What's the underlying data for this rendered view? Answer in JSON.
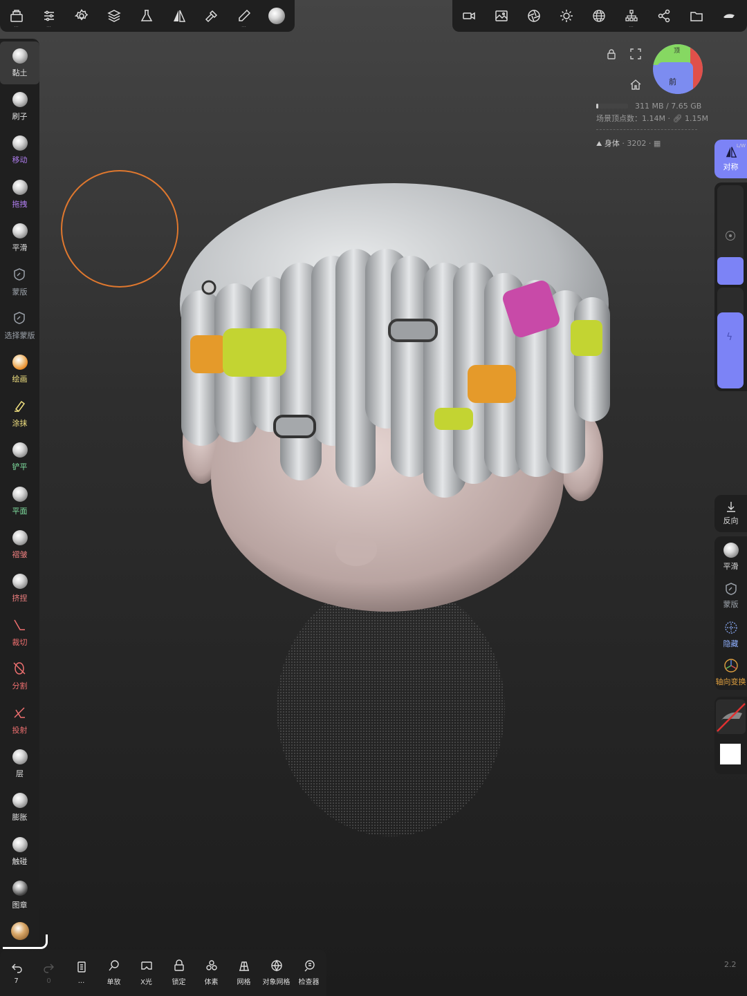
{
  "top_toolbar_left": [
    {
      "name": "gallery-icon"
    },
    {
      "name": "sliders-icon"
    },
    {
      "name": "settings-icon"
    },
    {
      "name": "layers-icon"
    },
    {
      "name": "flask-icon"
    },
    {
      "name": "symmetry-icon"
    },
    {
      "name": "hammer-icon"
    },
    {
      "name": "pen-icon"
    },
    {
      "name": "material-sphere-icon"
    }
  ],
  "top_toolbar_right": [
    {
      "name": "camera-icon"
    },
    {
      "name": "image-icon"
    },
    {
      "name": "aperture-icon"
    },
    {
      "name": "sun-icon"
    },
    {
      "name": "sphere-grid-icon"
    },
    {
      "name": "scene-tree-icon"
    },
    {
      "name": "share-icon"
    },
    {
      "name": "folder-icon"
    },
    {
      "name": "speed-icon"
    }
  ],
  "tools": [
    {
      "label": "黏土",
      "icon": "sphere",
      "color": "#e0e0e0"
    },
    {
      "label": "刷子",
      "icon": "sphere",
      "color": "#e0e0e0"
    },
    {
      "label": "移动",
      "icon": "sphere",
      "color": "#b07ef0"
    },
    {
      "label": "拖拽",
      "icon": "sphere",
      "color": "#b07ef0"
    },
    {
      "label": "平滑",
      "icon": "sphere",
      "color": "#e0e0e0"
    },
    {
      "label": "蒙版",
      "icon": "mask",
      "color": "#9aa0a8"
    },
    {
      "label": "选择蒙版",
      "icon": "mask",
      "color": "#9aa0a8"
    },
    {
      "label": "绘画",
      "icon": "orange",
      "color": "#f0e080"
    },
    {
      "label": "涂抹",
      "icon": "smudge",
      "color": "#f0e080"
    },
    {
      "label": "铲平",
      "icon": "sphere",
      "color": "#80e0a0"
    },
    {
      "label": "平面",
      "icon": "sphere",
      "color": "#80e0a0"
    },
    {
      "label": "褶皱",
      "icon": "sphere",
      "color": "#f08080"
    },
    {
      "label": "挤捏",
      "icon": "sphere",
      "color": "#f08080"
    },
    {
      "label": "裁切",
      "icon": "cut",
      "color": "#f07070"
    },
    {
      "label": "分割",
      "icon": "split",
      "color": "#f07070"
    },
    {
      "label": "投射",
      "icon": "project",
      "color": "#f07070"
    },
    {
      "label": "层",
      "icon": "sphere",
      "color": "#e0e0e0"
    },
    {
      "label": "膨胀",
      "icon": "sphere",
      "color": "#e0e0e0"
    },
    {
      "label": "触碰",
      "icon": "sphere",
      "color": "#e0e0e0"
    },
    {
      "label": "图章",
      "icon": "dark",
      "color": "#e0e0e0"
    }
  ],
  "bottom_toolbar": [
    {
      "name": "undo-icon",
      "label": "7"
    },
    {
      "name": "redo-icon",
      "label": "0"
    },
    {
      "name": "history-icon",
      "label": "..."
    },
    {
      "name": "solo-icon",
      "label": "单放"
    },
    {
      "name": "xray-icon",
      "label": "X光"
    },
    {
      "name": "lock-icon",
      "label": "锁定"
    },
    {
      "name": "voxel-icon",
      "label": "体素"
    },
    {
      "name": "wireframe-icon",
      "label": "网格"
    },
    {
      "name": "object-mesh-icon",
      "label": "对象网格"
    },
    {
      "name": "inspector-icon",
      "label": "检查器"
    }
  ],
  "hud": {
    "memory": "311 MB / 7.65 GB",
    "vertices_label": "场景顶点数：1.14M ·",
    "vertices_extra": "1.15M",
    "mesh_name": "身体",
    "mesh_count": "· 3202 ·"
  },
  "gizmo": {
    "top": "顶",
    "front": "前"
  },
  "right_panel": {
    "symmetry": "对称",
    "symmetry_badge": "L/W",
    "invert": "反向",
    "smooth": "平滑",
    "mask": "蒙版",
    "hide": "隐藏",
    "axis_transform": "轴向变换"
  },
  "version": "2.2",
  "colors": {
    "accent": "#7c83f6",
    "brush_ring": "#e0782e"
  }
}
